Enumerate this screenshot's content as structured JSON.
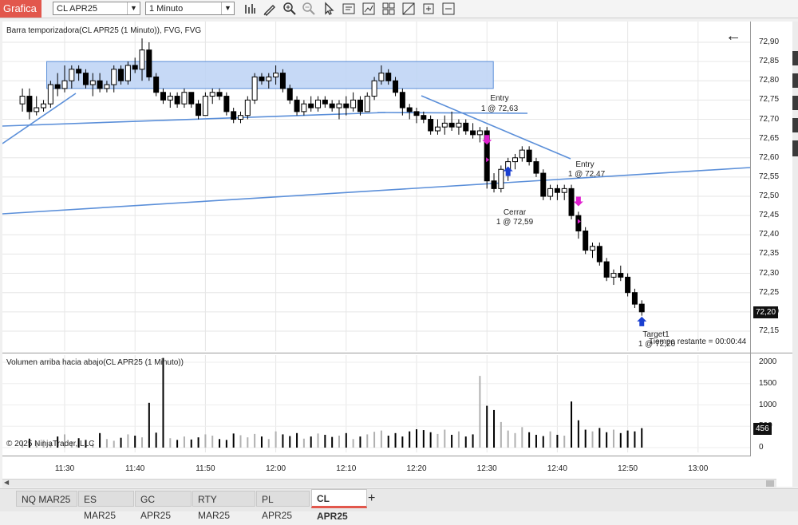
{
  "toolbar": {
    "app_title": "Grafica",
    "instrument": "CL APR25",
    "interval": "1 Minuto",
    "icons": [
      "bar-type-icon",
      "draw-tool-icon",
      "zoom-in-icon",
      "zoom-out-icon",
      "pointer-icon",
      "properties-icon",
      "strategy-icon",
      "template-icon",
      "crosshair-icon",
      "attach-icon",
      "share-icon"
    ]
  },
  "chart": {
    "price_panel_title": "Barra temporizadora(CL APR25 (1 Minuto)), FVG, FVG",
    "volume_panel_title": "Volumen arriba hacia abajo(CL APR25 (1 Minuto))",
    "copyright": "© 2025 NinjaTrader, LLC",
    "time_remaining": "Tiempo restante = 00:00:44",
    "current_price_label": "72,20",
    "current_volume_label": "456",
    "price_axis_labels": [
      "72,90",
      "72,85",
      "72,80",
      "72,75",
      "72,70",
      "72,65",
      "72,60",
      "72,55",
      "72,50",
      "72,45",
      "72,40",
      "72,35",
      "72,30",
      "72,25",
      "72,20",
      "72,15"
    ],
    "volume_axis_labels": [
      "2000",
      "1500",
      "1000",
      "500",
      "0"
    ],
    "time_axis_labels": [
      "11:30",
      "11:40",
      "11:50",
      "12:00",
      "12:10",
      "12:20",
      "12:30",
      "12:40",
      "12:50",
      "13:00"
    ],
    "annotations": {
      "entry1_label": "Entry",
      "entry1_detail": "1 @ 72,63",
      "entry2_label": "Entry",
      "entry2_detail": "1 @ 72,47",
      "exit_label": "Cerrar",
      "exit_detail": "1 @ 72,59",
      "target_label": "Target1",
      "target_detail": "1 @ 72,20"
    },
    "colors": {
      "up_candle": "#ffffff",
      "down_candle": "#000000",
      "fvg_zone": "#bcd2f5",
      "trendline": "#5b8fd9",
      "entry_arrow": "#e020d0",
      "exit_arrow": "#1a3fd0"
    }
  },
  "chart_data": {
    "type": "candlestick",
    "ylim": [
      72.12,
      72.93
    ],
    "candles_note": "1-minute OHLC, 11:24 to 12:52",
    "candles": [
      {
        "t": "11:24",
        "o": 72.74,
        "h": 72.78,
        "l": 72.72,
        "c": 72.76
      },
      {
        "t": "11:25",
        "o": 72.76,
        "h": 72.78,
        "l": 72.7,
        "c": 72.72
      },
      {
        "t": "11:26",
        "o": 72.72,
        "h": 72.76,
        "l": 72.71,
        "c": 72.73
      },
      {
        "t": "11:27",
        "o": 72.73,
        "h": 72.75,
        "l": 72.72,
        "c": 72.74
      },
      {
        "t": "11:28",
        "o": 72.74,
        "h": 72.8,
        "l": 72.73,
        "c": 72.79
      },
      {
        "t": "11:29",
        "o": 72.79,
        "h": 72.82,
        "l": 72.76,
        "c": 72.78
      },
      {
        "t": "11:30",
        "o": 72.78,
        "h": 72.84,
        "l": 72.77,
        "c": 72.8
      },
      {
        "t": "11:31",
        "o": 72.8,
        "h": 72.84,
        "l": 72.78,
        "c": 72.83
      },
      {
        "t": "11:32",
        "o": 72.83,
        "h": 72.84,
        "l": 72.8,
        "c": 72.82
      },
      {
        "t": "11:33",
        "o": 72.82,
        "h": 72.83,
        "l": 72.78,
        "c": 72.79
      },
      {
        "t": "11:34",
        "o": 72.79,
        "h": 72.82,
        "l": 72.76,
        "c": 72.8
      },
      {
        "t": "11:35",
        "o": 72.8,
        "h": 72.82,
        "l": 72.77,
        "c": 72.78
      },
      {
        "t": "11:36",
        "o": 72.78,
        "h": 72.8,
        "l": 72.77,
        "c": 72.79
      },
      {
        "t": "11:37",
        "o": 72.79,
        "h": 72.84,
        "l": 72.77,
        "c": 72.83
      },
      {
        "t": "11:38",
        "o": 72.83,
        "h": 72.84,
        "l": 72.79,
        "c": 72.8
      },
      {
        "t": "11:39",
        "o": 72.8,
        "h": 72.85,
        "l": 72.79,
        "c": 72.84
      },
      {
        "t": "11:40",
        "o": 72.84,
        "h": 72.86,
        "l": 72.82,
        "c": 72.83
      },
      {
        "t": "11:41",
        "o": 72.83,
        "h": 72.91,
        "l": 72.8,
        "c": 72.88
      },
      {
        "t": "11:42",
        "o": 72.88,
        "h": 72.9,
        "l": 72.8,
        "c": 72.81
      },
      {
        "t": "11:43",
        "o": 72.81,
        "h": 72.82,
        "l": 72.76,
        "c": 72.77
      },
      {
        "t": "11:44",
        "o": 72.77,
        "h": 72.78,
        "l": 72.74,
        "c": 72.75
      },
      {
        "t": "11:45",
        "o": 72.75,
        "h": 72.77,
        "l": 72.73,
        "c": 72.76
      },
      {
        "t": "11:46",
        "o": 72.76,
        "h": 72.77,
        "l": 72.73,
        "c": 72.74
      },
      {
        "t": "11:47",
        "o": 72.74,
        "h": 72.78,
        "l": 72.73,
        "c": 72.77
      },
      {
        "t": "11:48",
        "o": 72.77,
        "h": 72.77,
        "l": 72.73,
        "c": 72.74
      },
      {
        "t": "11:49",
        "o": 72.74,
        "h": 72.75,
        "l": 72.7,
        "c": 72.71
      },
      {
        "t": "11:50",
        "o": 72.71,
        "h": 72.77,
        "l": 72.71,
        "c": 72.76
      },
      {
        "t": "11:51",
        "o": 72.76,
        "h": 72.78,
        "l": 72.74,
        "c": 72.77
      },
      {
        "t": "11:52",
        "o": 72.77,
        "h": 72.78,
        "l": 72.75,
        "c": 72.76
      },
      {
        "t": "11:53",
        "o": 72.76,
        "h": 72.77,
        "l": 72.71,
        "c": 72.72
      },
      {
        "t": "11:54",
        "o": 72.72,
        "h": 72.73,
        "l": 72.69,
        "c": 72.7
      },
      {
        "t": "11:55",
        "o": 72.7,
        "h": 72.72,
        "l": 72.69,
        "c": 72.71
      },
      {
        "t": "11:56",
        "o": 72.71,
        "h": 72.76,
        "l": 72.7,
        "c": 72.75
      },
      {
        "t": "11:57",
        "o": 72.75,
        "h": 72.82,
        "l": 72.74,
        "c": 72.81
      },
      {
        "t": "11:58",
        "o": 72.81,
        "h": 72.82,
        "l": 72.79,
        "c": 72.8
      },
      {
        "t": "11:59",
        "o": 72.8,
        "h": 72.82,
        "l": 72.78,
        "c": 72.81
      },
      {
        "t": "12:00",
        "o": 72.81,
        "h": 72.84,
        "l": 72.79,
        "c": 72.82
      },
      {
        "t": "12:01",
        "o": 72.82,
        "h": 72.83,
        "l": 72.77,
        "c": 72.78
      },
      {
        "t": "12:02",
        "o": 72.78,
        "h": 72.79,
        "l": 72.74,
        "c": 72.75
      },
      {
        "t": "12:03",
        "o": 72.75,
        "h": 72.76,
        "l": 72.71,
        "c": 72.72
      },
      {
        "t": "12:04",
        "o": 72.72,
        "h": 72.75,
        "l": 72.71,
        "c": 72.74
      },
      {
        "t": "12:05",
        "o": 72.74,
        "h": 72.76,
        "l": 72.72,
        "c": 72.73
      },
      {
        "t": "12:06",
        "o": 72.73,
        "h": 72.76,
        "l": 72.72,
        "c": 72.75
      },
      {
        "t": "12:07",
        "o": 72.75,
        "h": 72.76,
        "l": 72.73,
        "c": 72.74
      },
      {
        "t": "12:08",
        "o": 72.74,
        "h": 72.75,
        "l": 72.72,
        "c": 72.73
      },
      {
        "t": "12:09",
        "o": 72.73,
        "h": 72.75,
        "l": 72.7,
        "c": 72.74
      },
      {
        "t": "12:10",
        "o": 72.74,
        "h": 72.76,
        "l": 72.71,
        "c": 72.73
      },
      {
        "t": "12:11",
        "o": 72.73,
        "h": 72.77,
        "l": 72.72,
        "c": 72.75
      },
      {
        "t": "12:12",
        "o": 72.75,
        "h": 72.76,
        "l": 72.71,
        "c": 72.72
      },
      {
        "t": "12:13",
        "o": 72.72,
        "h": 72.77,
        "l": 72.72,
        "c": 72.76
      },
      {
        "t": "12:14",
        "o": 72.76,
        "h": 72.81,
        "l": 72.75,
        "c": 72.8
      },
      {
        "t": "12:15",
        "o": 72.8,
        "h": 72.84,
        "l": 72.79,
        "c": 72.82
      },
      {
        "t": "12:16",
        "o": 72.82,
        "h": 72.83,
        "l": 72.79,
        "c": 72.8
      },
      {
        "t": "12:17",
        "o": 72.8,
        "h": 72.81,
        "l": 72.76,
        "c": 72.77
      },
      {
        "t": "12:18",
        "o": 72.77,
        "h": 72.78,
        "l": 72.71,
        "c": 72.73
      },
      {
        "t": "12:19",
        "o": 72.73,
        "h": 72.74,
        "l": 72.7,
        "c": 72.72
      },
      {
        "t": "12:20",
        "o": 72.72,
        "h": 72.73,
        "l": 72.69,
        "c": 72.71
      },
      {
        "t": "12:21",
        "o": 72.71,
        "h": 72.72,
        "l": 72.69,
        "c": 72.7
      },
      {
        "t": "12:22",
        "o": 72.7,
        "h": 72.71,
        "l": 72.66,
        "c": 72.67
      },
      {
        "t": "12:23",
        "o": 72.67,
        "h": 72.7,
        "l": 72.66,
        "c": 72.68
      },
      {
        "t": "12:24",
        "o": 72.68,
        "h": 72.71,
        "l": 72.66,
        "c": 72.69
      },
      {
        "t": "12:25",
        "o": 72.69,
        "h": 72.72,
        "l": 72.67,
        "c": 72.68
      },
      {
        "t": "12:26",
        "o": 72.68,
        "h": 72.7,
        "l": 72.66,
        "c": 72.69
      },
      {
        "t": "12:27",
        "o": 72.69,
        "h": 72.7,
        "l": 72.66,
        "c": 72.67
      },
      {
        "t": "12:28",
        "o": 72.67,
        "h": 72.69,
        "l": 72.65,
        "c": 72.66
      },
      {
        "t": "12:29",
        "o": 72.66,
        "h": 72.68,
        "l": 72.64,
        "c": 72.67
      },
      {
        "t": "12:30",
        "o": 72.67,
        "h": 72.68,
        "l": 72.52,
        "c": 72.54
      },
      {
        "t": "12:31",
        "o": 72.54,
        "h": 72.56,
        "l": 72.51,
        "c": 72.52
      },
      {
        "t": "12:32",
        "o": 72.52,
        "h": 72.58,
        "l": 72.51,
        "c": 72.57
      },
      {
        "t": "12:33",
        "o": 72.57,
        "h": 72.6,
        "l": 72.54,
        "c": 72.59
      },
      {
        "t": "12:34",
        "o": 72.59,
        "h": 72.61,
        "l": 72.57,
        "c": 72.6
      },
      {
        "t": "12:35",
        "o": 72.6,
        "h": 72.63,
        "l": 72.59,
        "c": 72.62
      },
      {
        "t": "12:36",
        "o": 72.62,
        "h": 72.63,
        "l": 72.58,
        "c": 72.59
      },
      {
        "t": "12:37",
        "o": 72.59,
        "h": 72.6,
        "l": 72.55,
        "c": 72.56
      },
      {
        "t": "12:38",
        "o": 72.56,
        "h": 72.57,
        "l": 72.49,
        "c": 72.5
      },
      {
        "t": "12:39",
        "o": 72.5,
        "h": 72.53,
        "l": 72.49,
        "c": 72.52
      },
      {
        "t": "12:40",
        "o": 72.52,
        "h": 72.53,
        "l": 72.49,
        "c": 72.51
      },
      {
        "t": "12:41",
        "o": 72.51,
        "h": 72.53,
        "l": 72.49,
        "c": 72.52
      },
      {
        "t": "12:42",
        "o": 72.52,
        "h": 72.53,
        "l": 72.44,
        "c": 72.45
      },
      {
        "t": "12:43",
        "o": 72.45,
        "h": 72.46,
        "l": 72.39,
        "c": 72.41
      },
      {
        "t": "12:44",
        "o": 72.41,
        "h": 72.42,
        "l": 72.35,
        "c": 72.36
      },
      {
        "t": "12:45",
        "o": 72.36,
        "h": 72.38,
        "l": 72.34,
        "c": 72.37
      },
      {
        "t": "12:46",
        "o": 72.37,
        "h": 72.38,
        "l": 72.32,
        "c": 72.33
      },
      {
        "t": "12:47",
        "o": 72.33,
        "h": 72.34,
        "l": 72.28,
        "c": 72.29
      },
      {
        "t": "12:48",
        "o": 72.29,
        "h": 72.31,
        "l": 72.27,
        "c": 72.3
      },
      {
        "t": "12:49",
        "o": 72.3,
        "h": 72.32,
        "l": 72.28,
        "c": 72.29
      },
      {
        "t": "12:50",
        "o": 72.29,
        "h": 72.3,
        "l": 72.24,
        "c": 72.25
      },
      {
        "t": "12:51",
        "o": 72.25,
        "h": 72.26,
        "l": 72.21,
        "c": 72.22
      },
      {
        "t": "12:52",
        "o": 72.22,
        "h": 72.23,
        "l": 72.19,
        "c": 72.2
      }
    ],
    "volume": {
      "ylim": [
        0,
        2000
      ],
      "values": [
        140,
        210,
        120,
        180,
        90,
        260,
        310,
        150,
        220,
        180,
        120,
        340,
        200,
        160,
        230,
        310,
        280,
        240,
        1050,
        350,
        2100,
        220,
        180,
        260,
        190,
        240,
        310,
        280,
        200,
        180,
        330,
        290,
        240,
        320,
        260,
        200,
        380,
        310,
        270,
        340,
        210,
        260,
        330,
        300,
        250,
        280,
        340,
        200,
        260,
        310,
        370,
        400,
        280,
        340,
        260,
        380,
        430,
        410,
        360,
        320,
        420,
        300,
        380,
        260,
        310,
        1680,
        980,
        880,
        600,
        400,
        340,
        480,
        360,
        300,
        270,
        380,
        300,
        280,
        1080,
        640,
        420,
        380,
        460,
        360,
        420,
        340,
        400,
        380,
        456
      ]
    },
    "fvg_zone": {
      "top": 72.85,
      "bottom": 72.78,
      "from": "11:27",
      "to": "12:30"
    },
    "trade_markers": [
      {
        "type": "entry",
        "time": "12:30",
        "price": 72.63
      },
      {
        "type": "exit",
        "time": "12:33",
        "price": 72.59
      },
      {
        "type": "entry",
        "time": "12:43",
        "price": 72.47
      },
      {
        "type": "target",
        "time": "12:52",
        "price": 72.2
      }
    ]
  },
  "tabs": [
    {
      "label": "NQ MAR25",
      "active": false
    },
    {
      "label": "ES MAR25",
      "active": false
    },
    {
      "label": "GC APR25",
      "active": false
    },
    {
      "label": "RTY MAR25",
      "active": false
    },
    {
      "label": "PL APR25",
      "active": false
    },
    {
      "label": "CL APR25",
      "active": true
    }
  ],
  "tab_add_label": "+"
}
